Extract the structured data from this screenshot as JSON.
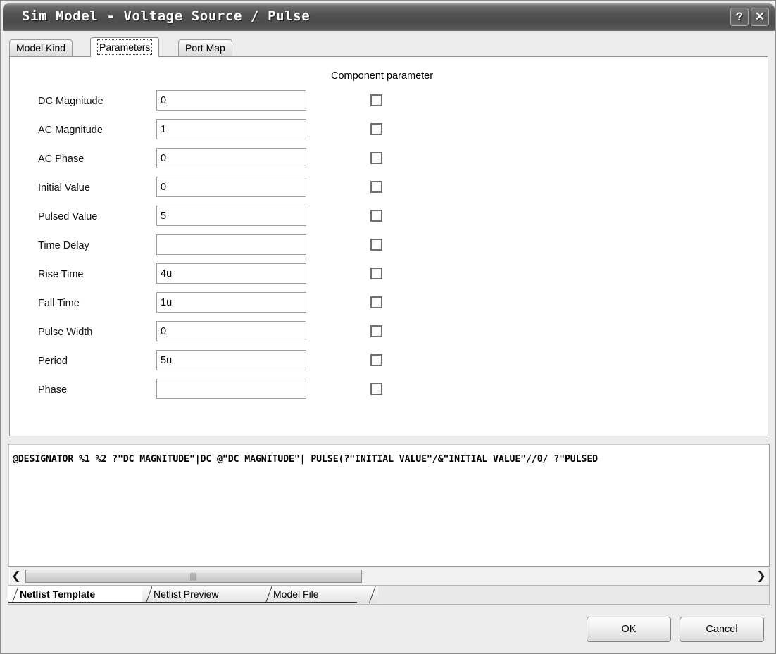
{
  "window": {
    "title": "Sim Model - Voltage Source / Pulse",
    "help_button": "?",
    "close_button": "✕",
    "help_icon_name": "help-icon",
    "close_icon_name": "close-icon"
  },
  "top_tabs": [
    {
      "label": "Model Kind",
      "active": false
    },
    {
      "label": "Parameters",
      "active": true
    },
    {
      "label": "Port Map",
      "active": false
    }
  ],
  "panel": {
    "column_header": "Component parameter",
    "rows": [
      {
        "label": "DC Magnitude",
        "value": "0",
        "checked": false
      },
      {
        "label": "AC Magnitude",
        "value": "1",
        "checked": false
      },
      {
        "label": "AC Phase",
        "value": "0",
        "checked": false
      },
      {
        "label": "Initial Value",
        "value": "0",
        "checked": false
      },
      {
        "label": "Pulsed Value",
        "value": "5",
        "checked": false
      },
      {
        "label": "Time Delay",
        "value": "",
        "checked": false
      },
      {
        "label": "Rise Time",
        "value": "4u",
        "checked": false
      },
      {
        "label": "Fall Time",
        "value": "1u",
        "checked": false
      },
      {
        "label": "Pulse Width",
        "value": "0",
        "checked": false
      },
      {
        "label": "Period",
        "value": "5u",
        "checked": false
      },
      {
        "label": "Phase",
        "value": "",
        "checked": false
      }
    ]
  },
  "netlist": {
    "text": "@DESIGNATOR %1 %2 ?\"DC MAGNITUDE\"|DC @\"DC MAGNITUDE\"| PULSE(?\"INITIAL VALUE\"/&\"INITIAL VALUE\"//0/ ?\"PULSED"
  },
  "scrollbar": {
    "left_arrow": "❮",
    "right_arrow": "❯"
  },
  "bottom_tabs": [
    {
      "label": "Netlist Template",
      "active": true
    },
    {
      "label": "Netlist Preview",
      "active": false
    },
    {
      "label": "Model File",
      "active": false
    }
  ],
  "footer": {
    "ok_label": "OK",
    "cancel_label": "Cancel"
  },
  "colors": {
    "titlebar": "#4c4c4c",
    "dialog_face": "#ececec",
    "panel_bg": "#ffffff",
    "border": "#8f8f8f",
    "text": "#000000"
  }
}
